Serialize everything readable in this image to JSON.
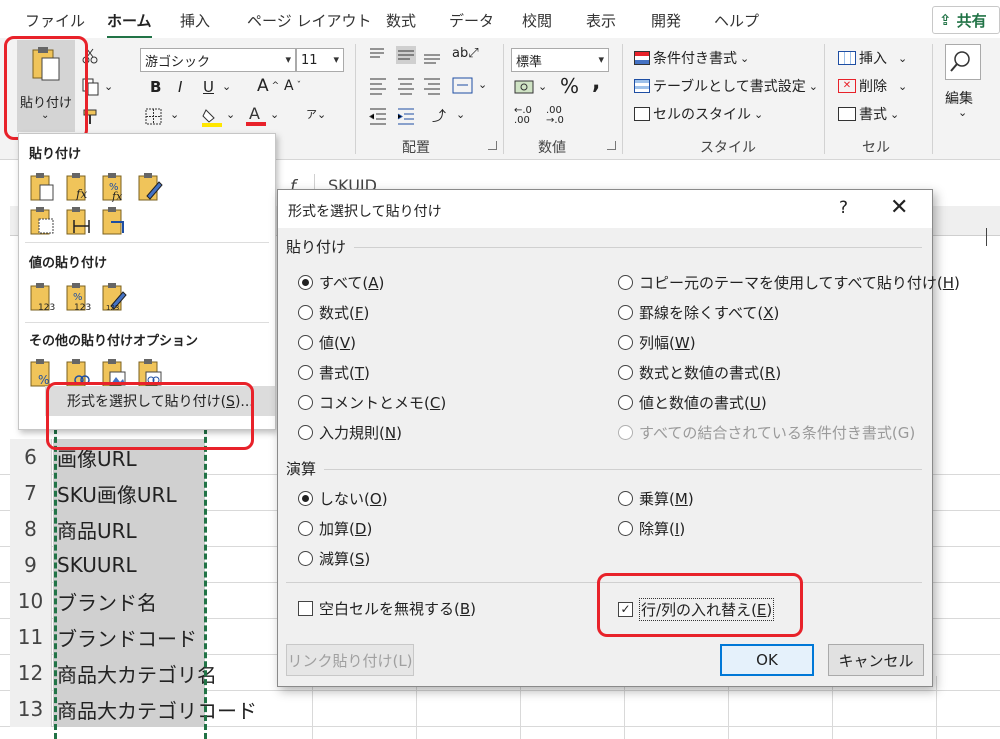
{
  "ribbon": {
    "tabs": [
      "ファイル",
      "ホーム",
      "挿入",
      "ページ レイアウト",
      "数式",
      "データ",
      "校閲",
      "表示",
      "開発",
      "ヘルプ"
    ],
    "active_tab": "ホーム",
    "share_label": "共有",
    "paste_label": "貼り付け",
    "font_name": "游ゴシック",
    "font_size": "11",
    "bold": "B",
    "italic": "I",
    "underline": "U",
    "grow_font": "A",
    "shrink_font": "A",
    "number_format": "標準",
    "percent": "%",
    "comma": ",",
    "conditional_format": "条件付き書式",
    "format_as_table": "テーブルとして書式設定",
    "cell_styles": "セルのスタイル",
    "insert": "挿入",
    "delete": "削除",
    "format": "書式",
    "edit": "編集",
    "group_alignment": "配置",
    "group_number": "数値",
    "group_styles": "スタイル",
    "group_cells": "セル",
    "accent_color": "#217346",
    "highlight_color": "#e8222a"
  },
  "formula_bar": {
    "fx": "f",
    "content": "SKUID"
  },
  "sheet": {
    "rows": [
      {
        "num": "6",
        "value": "画像URL"
      },
      {
        "num": "7",
        "value": "SKU画像URL"
      },
      {
        "num": "8",
        "value": "商品URL"
      },
      {
        "num": "9",
        "value": "SKUURL"
      },
      {
        "num": "10",
        "value": "ブランド名"
      },
      {
        "num": "11",
        "value": "ブランドコード"
      },
      {
        "num": "12",
        "value": "商品大カテゴリ名"
      },
      {
        "num": "13",
        "value": "商品大カテゴリコード"
      }
    ]
  },
  "paste_menu": {
    "section_paste": "貼り付け",
    "section_values": "値の貼り付け",
    "section_other": "その他の貼り付けオプション",
    "paste_special_prefix": "形式を選択して貼り付け(",
    "paste_special_key": "S",
    "paste_special_suffix": ")..."
  },
  "dialog": {
    "title": "形式を選択して貼り付け",
    "help": "?",
    "close": "✕",
    "section_paste": "貼り付け",
    "section_operation": "演算",
    "paste_options_left": [
      {
        "text": "すべて",
        "key": "A",
        "checked": true
      },
      {
        "text": "数式",
        "key": "F",
        "checked": false
      },
      {
        "text": "値",
        "key": "V",
        "checked": false
      },
      {
        "text": "書式",
        "key": "T",
        "checked": false
      },
      {
        "text": "コメントとメモ",
        "key": "C",
        "checked": false
      },
      {
        "text": "入力規則",
        "key": "N",
        "checked": false
      }
    ],
    "paste_options_right": [
      {
        "text": "コピー元のテーマを使用してすべて貼り付け",
        "key": "H",
        "checked": false,
        "disabled": false
      },
      {
        "text": "罫線を除くすべて",
        "key": "X",
        "checked": false,
        "disabled": false
      },
      {
        "text": "列幅",
        "key": "W",
        "checked": false,
        "disabled": false
      },
      {
        "text": "数式と数値の書式",
        "key": "R",
        "checked": false,
        "disabled": false
      },
      {
        "text": "値と数値の書式",
        "key": "U",
        "checked": false,
        "disabled": false
      },
      {
        "text": "すべての結合されている条件付き書式",
        "key": "G",
        "checked": false,
        "disabled": true
      }
    ],
    "operation_left": [
      {
        "text": "しない",
        "key": "O",
        "checked": true
      },
      {
        "text": "加算",
        "key": "D",
        "checked": false
      },
      {
        "text": "減算",
        "key": "S",
        "checked": false
      }
    ],
    "operation_right": [
      {
        "text": "乗算",
        "key": "M",
        "checked": false
      },
      {
        "text": "除算",
        "key": "I",
        "checked": false
      }
    ],
    "skip_blanks": {
      "text": "空白セルを無視する",
      "key": "B",
      "checked": false
    },
    "transpose": {
      "text": "行/列の入れ替え",
      "key": "E",
      "checked": true
    },
    "paste_link": "リンク貼り付け(L)",
    "ok": "OK",
    "cancel": "キャンセル"
  }
}
